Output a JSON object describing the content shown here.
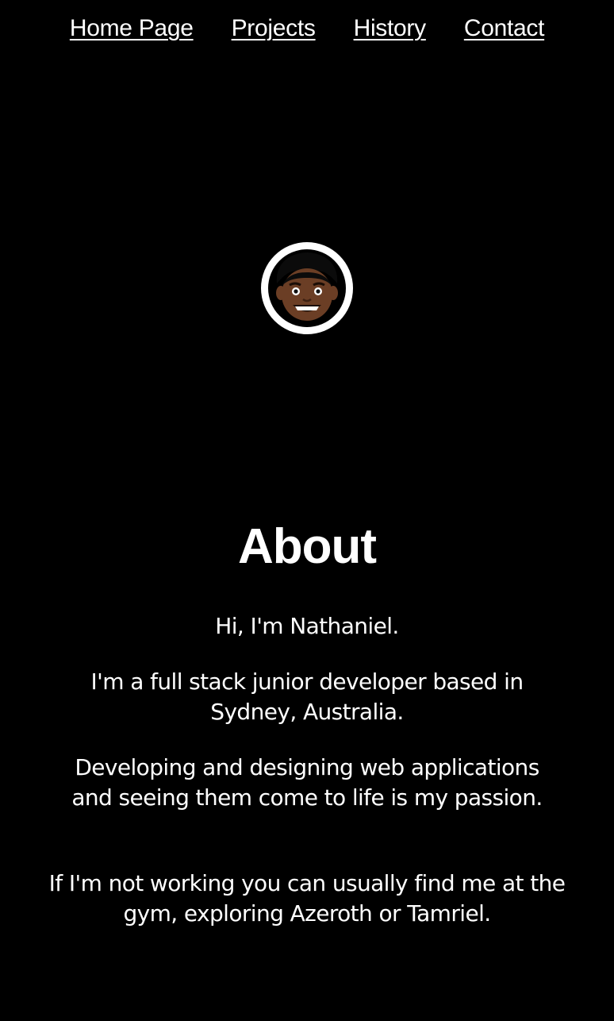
{
  "nav": {
    "items": [
      {
        "label": "Home Page"
      },
      {
        "label": "Projects"
      },
      {
        "label": "History"
      },
      {
        "label": "Contact"
      }
    ]
  },
  "avatar": {
    "icon": "cartoon-face-avatar"
  },
  "about": {
    "heading": "About",
    "paragraphs": [
      "Hi, I'm Nathaniel.",
      "I'm a full stack junior developer based in Sydney, Australia.",
      "Developing and designing web applications and seeing them come to life is my passion.",
      "If I'm not working you can usually find me at the gym, exploring Azeroth or Tamriel."
    ]
  },
  "colors": {
    "background": "#000000",
    "text": "#ffffff",
    "skin": "#6b3e25",
    "hair": "#0b0b0b"
  }
}
